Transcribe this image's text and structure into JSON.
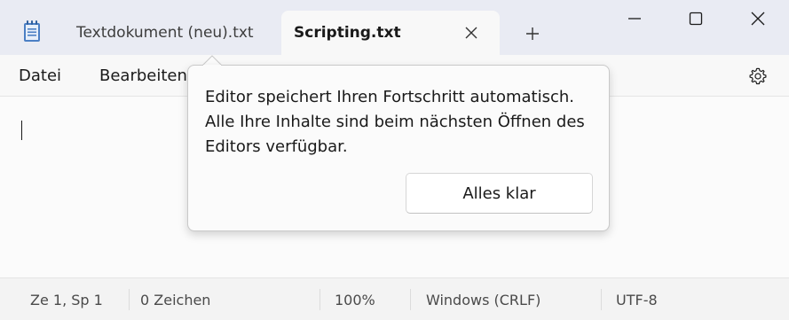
{
  "titlebar": {
    "app_icon": "notepad-icon",
    "tabs": [
      {
        "label": "Textdokument (neu).txt",
        "active": false
      },
      {
        "label": "Scripting.txt",
        "active": true
      }
    ],
    "tab_close_icon": "close-icon",
    "new_tab_icon": "plus-icon",
    "window_controls": [
      "minimize-icon",
      "maximize-icon",
      "close-icon"
    ]
  },
  "menu": {
    "items": [
      "Datei",
      "Bearbeiten"
    ],
    "settings_icon": "gear-icon"
  },
  "editor": {
    "content": ""
  },
  "popup": {
    "lines": [
      "Editor speichert Ihren Fortschritt automatisch.",
      "Alle Ihre Inhalte sind beim nächsten Öffnen des",
      "Editors verfügbar."
    ],
    "button_label": "Alles klar"
  },
  "statusbar": {
    "position": "Ze 1, Sp 1",
    "char_count": "0 Zeichen",
    "zoom": "100%",
    "line_ending": "Windows (CRLF)",
    "encoding": "UTF-8"
  },
  "colors": {
    "titlebar_bg": "#e9ebf3",
    "active_tab_bg": "#f8f8f8",
    "editor_bg": "#fbfbfb",
    "statusbar_bg": "#f3f3f3"
  }
}
